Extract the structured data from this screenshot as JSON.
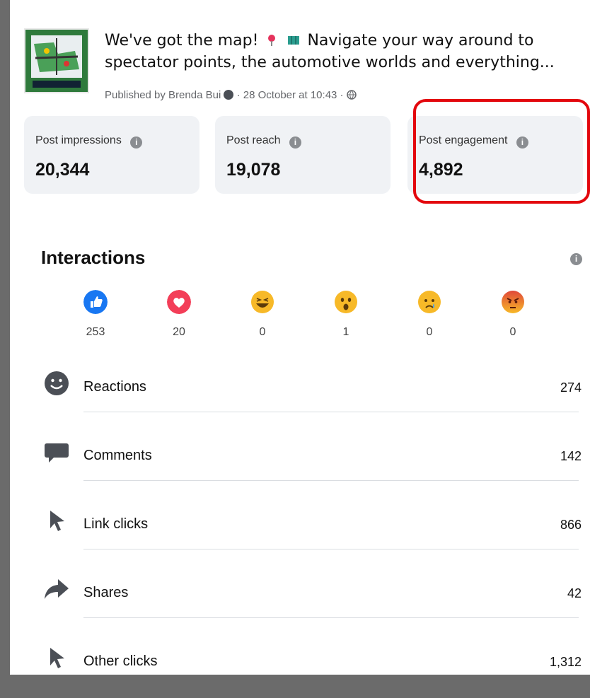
{
  "post": {
    "title_line1": "We've got the map!",
    "title_line1_rest": "Navigate your way around to",
    "title_line2": "spectator points, the automotive worlds and everything...",
    "meta_published": "Published by Brenda Bui",
    "meta_date": "· 28 October at 10:43 ·"
  },
  "metrics": [
    {
      "label": "Post impressions",
      "value": "20,344"
    },
    {
      "label": "Post reach",
      "value": "19,078"
    },
    {
      "label": "Post engagement",
      "value": "4,892"
    }
  ],
  "interactions": {
    "title": "Interactions",
    "reactions": [
      {
        "icon": "like-icon",
        "count": "253"
      },
      {
        "icon": "love-icon",
        "count": "20"
      },
      {
        "icon": "haha-icon",
        "count": "0"
      },
      {
        "icon": "wow-icon",
        "count": "1"
      },
      {
        "icon": "sad-icon",
        "count": "0"
      },
      {
        "icon": "angry-icon",
        "count": "0"
      }
    ],
    "rows": [
      {
        "icon": "smiley-icon",
        "label": "Reactions",
        "value": "274"
      },
      {
        "icon": "comment-icon",
        "label": "Comments",
        "value": "142"
      },
      {
        "icon": "cursor-icon",
        "label": "Link clicks",
        "value": "866"
      },
      {
        "icon": "share-icon",
        "label": "Shares",
        "value": "42"
      },
      {
        "icon": "cursor-icon",
        "label": "Other clicks",
        "value": "1,312"
      }
    ]
  },
  "colors": {
    "highlight": "#e3070d",
    "like": "#1877f2",
    "love": "#f33e58",
    "emoji_yellow": "#f7b928",
    "angry": "#e9710f"
  }
}
